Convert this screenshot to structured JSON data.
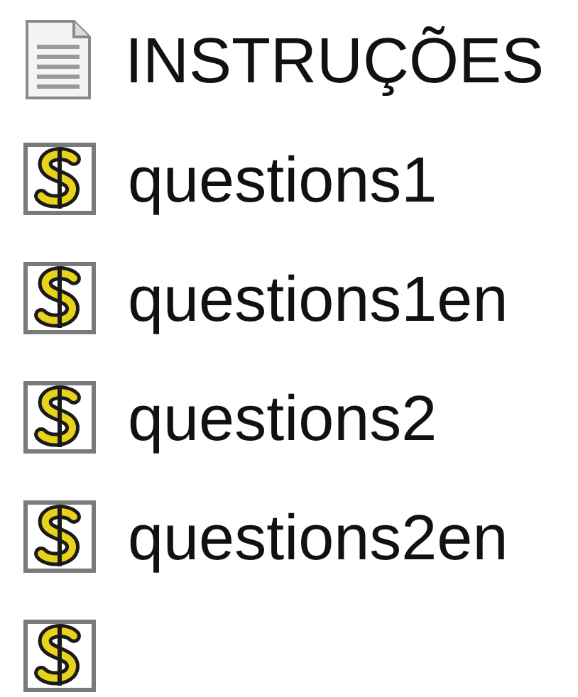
{
  "files": [
    {
      "kind": "text",
      "name": "INSTRUÇÕES"
    },
    {
      "kind": "script",
      "name": "questions1"
    },
    {
      "kind": "script",
      "name": "questions1en"
    },
    {
      "kind": "script",
      "name": "questions2"
    },
    {
      "kind": "script",
      "name": "questions2en"
    },
    {
      "kind": "script"
    }
  ]
}
